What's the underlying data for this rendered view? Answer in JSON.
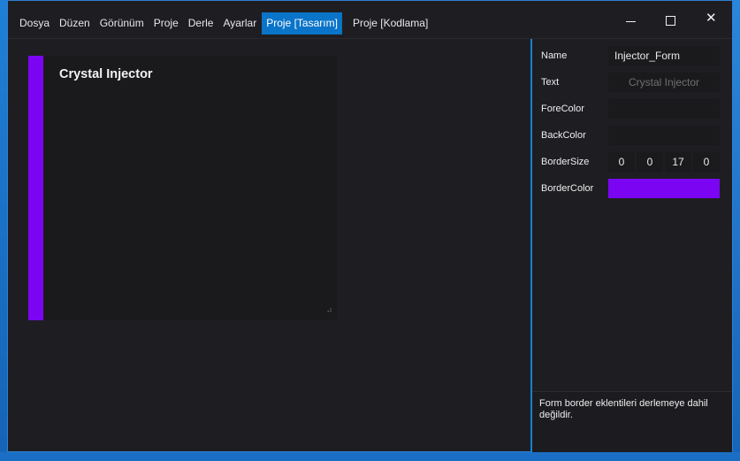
{
  "menu": {
    "items": [
      "Dosya",
      "Düzen",
      "Görünüm",
      "Proje",
      "Derle",
      "Ayarlar"
    ],
    "active_tab": "Proje  [Tasarım]",
    "code_tab": "Proje  [Kodlama]"
  },
  "window_controls": {
    "minimize_icon": "minimize-icon",
    "maximize_icon": "maximize-icon",
    "close_icon": "close-icon",
    "close_glyph": "✕"
  },
  "designer": {
    "form_title": "Crystal Injector",
    "border_color": "#7b05f2",
    "resize_grip": "⠴"
  },
  "properties": {
    "name": {
      "label": "Name",
      "value": "Injector_Form"
    },
    "text": {
      "label": "Text",
      "placeholder": "Crystal Injector"
    },
    "fore_color": {
      "label": "ForeColor",
      "value": ""
    },
    "back_color": {
      "label": "BackColor",
      "value": ""
    },
    "border_size": {
      "label": "BorderSize",
      "values": [
        "0",
        "0",
        "17",
        "0"
      ]
    },
    "border_color": {
      "label": "BorderColor",
      "value": "#7b05f2"
    }
  },
  "info": {
    "text": "Form border eklentileri derlemeye dahil değildir."
  },
  "colors": {
    "accent": "#0a74c9",
    "panel_border": "#1681d0",
    "background": "#1e1e22"
  }
}
